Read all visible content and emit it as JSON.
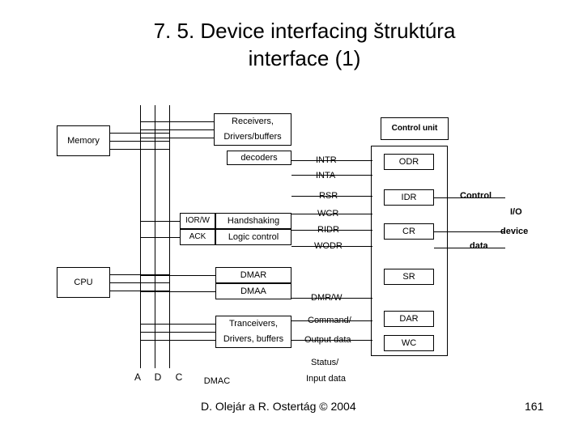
{
  "title": "7. 5. Device interfacing štruktúra interface (1)",
  "left": {
    "memory": "Memory",
    "cpu": "CPU",
    "bus": "A  D  C"
  },
  "center": {
    "receivers": "Receivers,",
    "drivers_buffers": "Drivers/buffers",
    "decoders": "decoders",
    "iorw": "IOR/W",
    "ack": "ACK",
    "handshaking": "Handshaking",
    "logic": "Logic control",
    "dmar": "DMAR",
    "dmaa": "DMAA",
    "tranceivers": "Tranceivers,",
    "drivers_buffers2": "Drivers, buffers",
    "dmac": "DMAC"
  },
  "signals": {
    "intr": "INTR",
    "inta": "INTA",
    "rsr": "RSR",
    "wcr": "WCR",
    "ridr": "RIDR",
    "wodr": "WODR",
    "dmrw": "DMR/W",
    "command": "Command/",
    "outputdata": "Output data",
    "status": "Status/",
    "inputdata": "Input data"
  },
  "right": {
    "ctrlunit": "Control unit",
    "odr": "ODR",
    "idr": "IDR",
    "cr": "CR",
    "sr": "SR",
    "dar": "DAR",
    "wc": "WC"
  },
  "right_ext": {
    "control": "Control",
    "io": "I/O",
    "device": "device",
    "data": "data"
  },
  "footer": "D. Olejár a R. Ostertág © 2004",
  "page": "161"
}
